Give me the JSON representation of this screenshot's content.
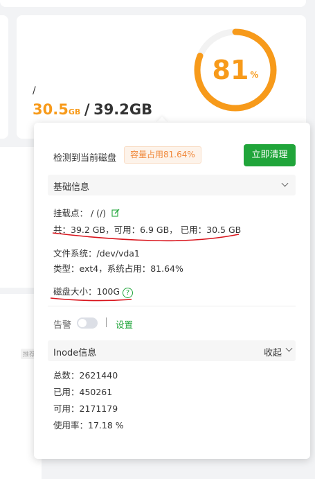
{
  "disk_card": {
    "mount": "/",
    "used_value": "30.5",
    "used_unit": "GB",
    "separator": "/",
    "total_value": "39.2",
    "total_unit": "GB",
    "usage_percent_text": "81",
    "percent_sign": "%",
    "usage_fraction": 0.81
  },
  "background": {
    "tag": "推荐"
  },
  "popover": {
    "detect_text": "检测到当前磁盘",
    "usage_tag": "容量占用81.64%",
    "clean_button": "立即清理",
    "basic_info": {
      "title": "基础信息",
      "mount_point": "挂载点： / (/)",
      "space_line": "共：39.2 GB，可用：6.9 GB， 已用：30.5 GB",
      "filesystem": "文件系统：/dev/vda1",
      "type_line": "类型：ext4，系统占用：81.64%",
      "disk_size": "磁盘大小：100G",
      "help_glyph": "?"
    },
    "alarm": {
      "label": "告警",
      "toggle_on": false,
      "settings_link": "设置"
    },
    "inode": {
      "title": "Inode信息",
      "collapse_label": "收起",
      "total": "总数：2621440",
      "used": "已用：450261",
      "available": "可用：2171179",
      "usage_rate": "使用率：17.18 %"
    }
  },
  "colors": {
    "accent_orange": "#f79a1a",
    "brand_green": "#20a53a",
    "annotation_red": "#d9141c"
  }
}
